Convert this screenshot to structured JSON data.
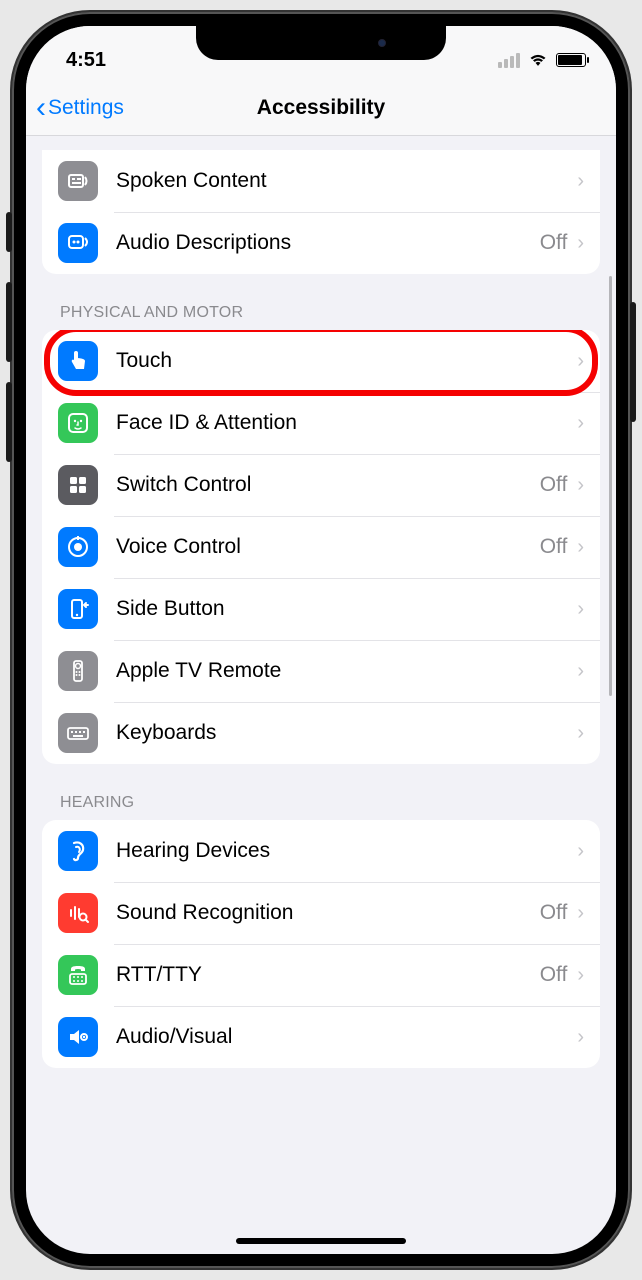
{
  "status": {
    "time": "4:51"
  },
  "nav": {
    "back_label": "Settings",
    "title": "Accessibility"
  },
  "off_text": "Off",
  "sections": [
    {
      "header": null,
      "rows": [
        {
          "id": "spoken-content",
          "label": "Spoken Content",
          "value": null,
          "icon": "spoken-content-icon",
          "bg": "bg-gray"
        },
        {
          "id": "audio-descriptions",
          "label": "Audio Descriptions",
          "value": "Off",
          "icon": "audio-descriptions-icon",
          "bg": "bg-blue"
        }
      ]
    },
    {
      "header": "PHYSICAL AND MOTOR",
      "rows": [
        {
          "id": "touch",
          "label": "Touch",
          "value": null,
          "icon": "touch-icon",
          "bg": "bg-blue",
          "highlighted": true
        },
        {
          "id": "face-id-attention",
          "label": "Face ID & Attention",
          "value": null,
          "icon": "faceid-icon",
          "bg": "bg-green"
        },
        {
          "id": "switch-control",
          "label": "Switch Control",
          "value": "Off",
          "icon": "switch-control-icon",
          "bg": "bg-darkgray"
        },
        {
          "id": "voice-control",
          "label": "Voice Control",
          "value": "Off",
          "icon": "voice-control-icon",
          "bg": "bg-blue"
        },
        {
          "id": "side-button",
          "label": "Side Button",
          "value": null,
          "icon": "side-button-icon",
          "bg": "bg-blue"
        },
        {
          "id": "apple-tv-remote",
          "label": "Apple TV Remote",
          "value": null,
          "icon": "appletv-remote-icon",
          "bg": "bg-gray"
        },
        {
          "id": "keyboards",
          "label": "Keyboards",
          "value": null,
          "icon": "keyboards-icon",
          "bg": "bg-gray"
        }
      ]
    },
    {
      "header": "HEARING",
      "rows": [
        {
          "id": "hearing-devices",
          "label": "Hearing Devices",
          "value": null,
          "icon": "hearing-devices-icon",
          "bg": "bg-blue"
        },
        {
          "id": "sound-recognition",
          "label": "Sound Recognition",
          "value": "Off",
          "icon": "sound-recognition-icon",
          "bg": "bg-red"
        },
        {
          "id": "rtt-tty",
          "label": "RTT/TTY",
          "value": "Off",
          "icon": "rtt-tty-icon",
          "bg": "bg-green"
        },
        {
          "id": "audio-visual",
          "label": "Audio/Visual",
          "value": null,
          "icon": "audio-visual-icon",
          "bg": "bg-blue"
        }
      ]
    }
  ]
}
